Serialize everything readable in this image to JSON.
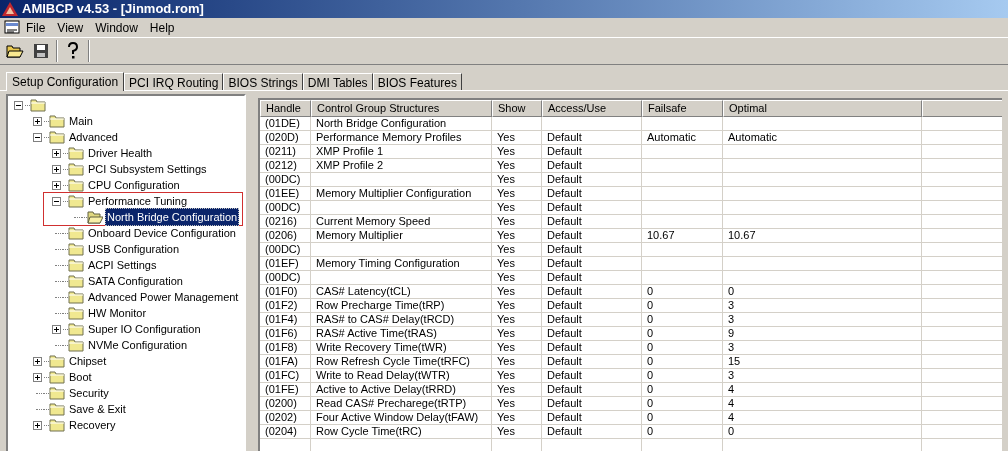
{
  "window": {
    "title": "AMIBCP v4.53 - [Jinmod.rom]"
  },
  "menu": [
    "File",
    "View",
    "Window",
    "Help"
  ],
  "tabs": [
    {
      "label": "Setup Configuration",
      "selected": true
    },
    {
      "label": "PCI IRQ Routing",
      "selected": false
    },
    {
      "label": "BIOS Strings",
      "selected": false
    },
    {
      "label": "DMI Tables",
      "selected": false
    },
    {
      "label": "BIOS Features",
      "selected": false
    }
  ],
  "tree": [
    {
      "kind": "branch",
      "expanded": true,
      "selected": false,
      "children": [
        {
          "label": "Main",
          "kind": "branch",
          "expanded": false,
          "selected": false
        },
        {
          "label": "Advanced",
          "kind": "branch",
          "expanded": true,
          "selected": false,
          "children": [
            {
              "label": "Driver Health",
              "kind": "branch",
              "expanded": false,
              "selected": false
            },
            {
              "label": "PCI Subsystem Settings",
              "kind": "branch",
              "expanded": false,
              "selected": false
            },
            {
              "label": "CPU Configuration",
              "kind": "branch",
              "expanded": false,
              "selected": false
            },
            {
              "label": "Performance Tuning",
              "kind": "branch",
              "expanded": true,
              "selected": false,
              "boxed": true,
              "children": [
                {
                  "label": "North Bridge Configuration",
                  "kind": "leaf",
                  "selected": true
                }
              ]
            },
            {
              "label": "Onboard Device Configuration",
              "kind": "leaf",
              "selected": false
            },
            {
              "label": "USB Configuration",
              "kind": "leaf",
              "selected": false
            },
            {
              "label": "ACPI Settings",
              "kind": "leaf",
              "selected": false
            },
            {
              "label": "SATA Configuration",
              "kind": "leaf",
              "selected": false
            },
            {
              "label": "Advanced Power Management",
              "kind": "leaf",
              "selected": false
            },
            {
              "label": "HW Monitor",
              "kind": "leaf",
              "selected": false
            },
            {
              "label": "Super IO Configuration",
              "kind": "branch",
              "expanded": false,
              "selected": false
            },
            {
              "label": "NVMe Configuration",
              "kind": "leaf",
              "selected": false
            }
          ]
        },
        {
          "label": "Chipset",
          "kind": "branch",
          "expanded": false,
          "selected": false
        },
        {
          "label": "Boot",
          "kind": "branch",
          "expanded": false,
          "selected": false
        },
        {
          "label": "Security",
          "kind": "leaf",
          "selected": false
        },
        {
          "label": "Save & Exit",
          "kind": "leaf",
          "selected": false
        },
        {
          "label": "Recovery",
          "kind": "branch",
          "expanded": false,
          "selected": false
        }
      ]
    }
  ],
  "table": {
    "columns": [
      "Handle",
      "Control Group Structures",
      "Show",
      "Access/Use",
      "Failsafe",
      "Optimal"
    ],
    "rows": [
      {
        "handle": "(01DE)",
        "structure": "North Bridge Configuration"
      },
      {
        "handle": "(020D)",
        "structure": "Performance Memory Profiles",
        "show": "Yes",
        "access": "Default",
        "failsafe": "Automatic",
        "optimal": "Automatic"
      },
      {
        "handle": "(0211)",
        "structure": "XMP Profile 1",
        "show": "Yes",
        "access": "Default"
      },
      {
        "handle": "(0212)",
        "structure": "XMP Profile 2",
        "show": "Yes",
        "access": "Default"
      },
      {
        "handle": "(00DC)",
        "show": "Yes",
        "access": "Default"
      },
      {
        "handle": "(01EE)",
        "structure": "Memory Multiplier Configuration",
        "show": "Yes",
        "access": "Default"
      },
      {
        "handle": "(00DC)",
        "show": "Yes",
        "access": "Default"
      },
      {
        "handle": "(0216)",
        "structure": "Current Memory Speed",
        "show": "Yes",
        "access": "Default"
      },
      {
        "handle": "(0206)",
        "structure": "Memory Multiplier",
        "show": "Yes",
        "access": "Default",
        "failsafe": "10.67",
        "optimal": "10.67"
      },
      {
        "handle": "(00DC)",
        "show": "Yes",
        "access": "Default"
      },
      {
        "handle": "(01EF)",
        "structure": "Memory Timing Configuration",
        "show": "Yes",
        "access": "Default"
      },
      {
        "handle": "(00DC)",
        "show": "Yes",
        "access": "Default"
      },
      {
        "handle": "(01F0)",
        "structure": "CAS# Latency(tCL)",
        "show": "Yes",
        "access": "Default",
        "failsafe": "0",
        "optimal": "0"
      },
      {
        "handle": "(01F2)",
        "structure": "Row Precharge Time(tRP)",
        "show": "Yes",
        "access": "Default",
        "failsafe": "0",
        "optimal": "3"
      },
      {
        "handle": "(01F4)",
        "structure": "RAS# to CAS# Delay(tRCD)",
        "show": "Yes",
        "access": "Default",
        "failsafe": "0",
        "optimal": "3"
      },
      {
        "handle": "(01F6)",
        "structure": "RAS# Active Time(tRAS)",
        "show": "Yes",
        "access": "Default",
        "failsafe": "0",
        "optimal": "9"
      },
      {
        "handle": "(01F8)",
        "structure": "Write Recovery Time(tWR)",
        "show": "Yes",
        "access": "Default",
        "failsafe": "0",
        "optimal": "3"
      },
      {
        "handle": "(01FA)",
        "structure": "Row Refresh Cycle Time(tRFC)",
        "show": "Yes",
        "access": "Default",
        "failsafe": "0",
        "optimal": "15"
      },
      {
        "handle": "(01FC)",
        "structure": "Write to Read Delay(tWTR)",
        "show": "Yes",
        "access": "Default",
        "failsafe": "0",
        "optimal": "3"
      },
      {
        "handle": "(01FE)",
        "structure": "Active to Active Delay(tRRD)",
        "show": "Yes",
        "access": "Default",
        "failsafe": "0",
        "optimal": "4"
      },
      {
        "handle": "(0200)",
        "structure": "Read CAS# Precharege(tRTP)",
        "show": "Yes",
        "access": "Default",
        "failsafe": "0",
        "optimal": "4"
      },
      {
        "handle": "(0202)",
        "structure": "Four Active Window Delay(tFAW)",
        "show": "Yes",
        "access": "Default",
        "failsafe": "0",
        "optimal": "4"
      },
      {
        "handle": "(0204)",
        "structure": "Row Cycle Time(tRC)",
        "show": "Yes",
        "access": "Default",
        "failsafe": "0",
        "optimal": "0"
      }
    ]
  }
}
